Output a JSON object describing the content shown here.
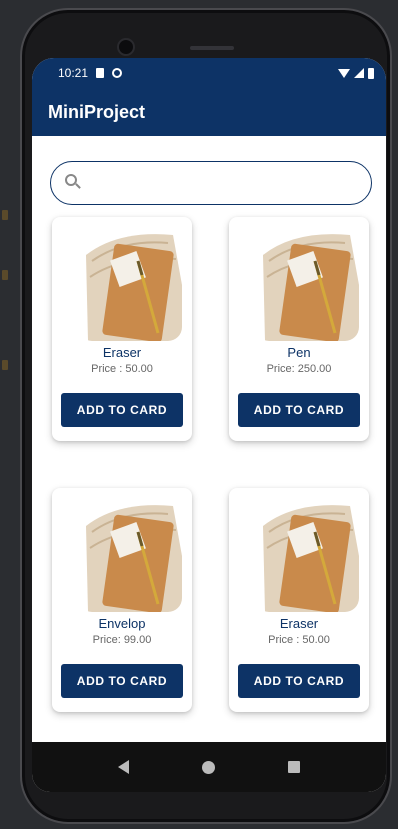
{
  "statusbar": {
    "time": "10:21"
  },
  "appbar": {
    "title": "MiniProject"
  },
  "search": {
    "placeholder": "",
    "value": ""
  },
  "products": [
    {
      "name": "Eraser",
      "price": "Price : 50.00",
      "button": "ADD TO CARD"
    },
    {
      "name": "Pen",
      "price": "Price: 250.00",
      "button": "ADD TO CARD"
    },
    {
      "name": "Envelop",
      "price": "Price: 99.00",
      "button": "ADD TO CARD"
    },
    {
      "name": "Eraser",
      "price": "Price : 50.00",
      "button": "ADD TO CARD"
    }
  ],
  "icons": {
    "status_left": [
      "sd-card-icon",
      "sync-icon"
    ],
    "status_right": [
      "wifi-icon",
      "signal-icon",
      "battery-icon"
    ],
    "search": "search-icon",
    "nav": [
      "back-icon",
      "home-icon",
      "recents-icon"
    ]
  },
  "colors": {
    "primary": "#0d3366",
    "background": "#ffffff"
  }
}
